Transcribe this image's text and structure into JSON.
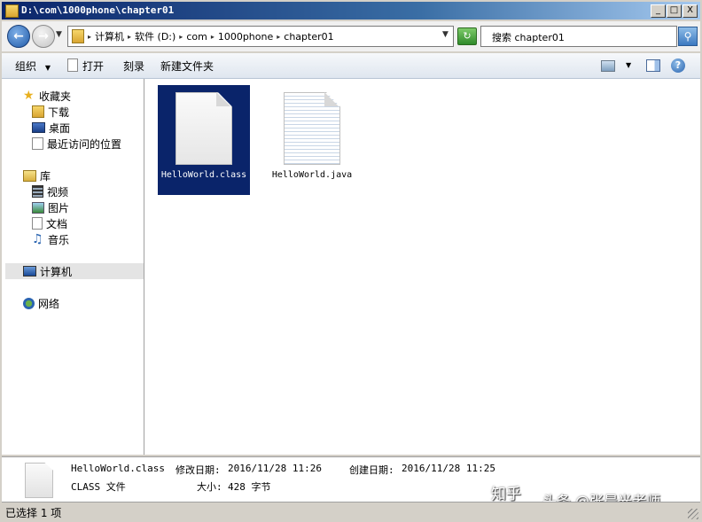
{
  "window": {
    "title": "D:\\com\\1000phone\\chapter01",
    "minimize": "_",
    "maximize": "□",
    "close": "X"
  },
  "address": {
    "crumbs": [
      "计算机",
      "软件 (D:)",
      "com",
      "1000phone",
      "chapter01"
    ]
  },
  "search": {
    "placeholder": "搜索 chapter01"
  },
  "toolbar": {
    "organize": "组织",
    "open": "打开",
    "burn": "刻录",
    "new_folder": "新建文件夹"
  },
  "sidebar": {
    "favorites": {
      "label": "收藏夹",
      "items": [
        "下载",
        "桌面",
        "最近访问的位置"
      ]
    },
    "libraries": {
      "label": "库",
      "items": [
        "视频",
        "图片",
        "文档",
        "音乐"
      ]
    },
    "computer": "计算机",
    "network": "网络"
  },
  "files": [
    {
      "name": "HelloWorld.class",
      "selected": true
    },
    {
      "name": "HelloWorld.java",
      "selected": false
    }
  ],
  "details": {
    "filename": "HelloWorld.class",
    "modified_label": "修改日期:",
    "modified": "2016/11/28 11:26",
    "created_label": "创建日期:",
    "created": "2016/11/28 11:25",
    "type": "CLASS 文件",
    "size_label": "大小:",
    "size": "428 字节"
  },
  "watermark": {
    "left": "知乎",
    "right": "头条 @张晨光老师"
  },
  "status": "已选择 1 项",
  "colors": {
    "selection": "#0a246a",
    "title_start": "#0a246a",
    "title_end": "#a6caf0"
  }
}
